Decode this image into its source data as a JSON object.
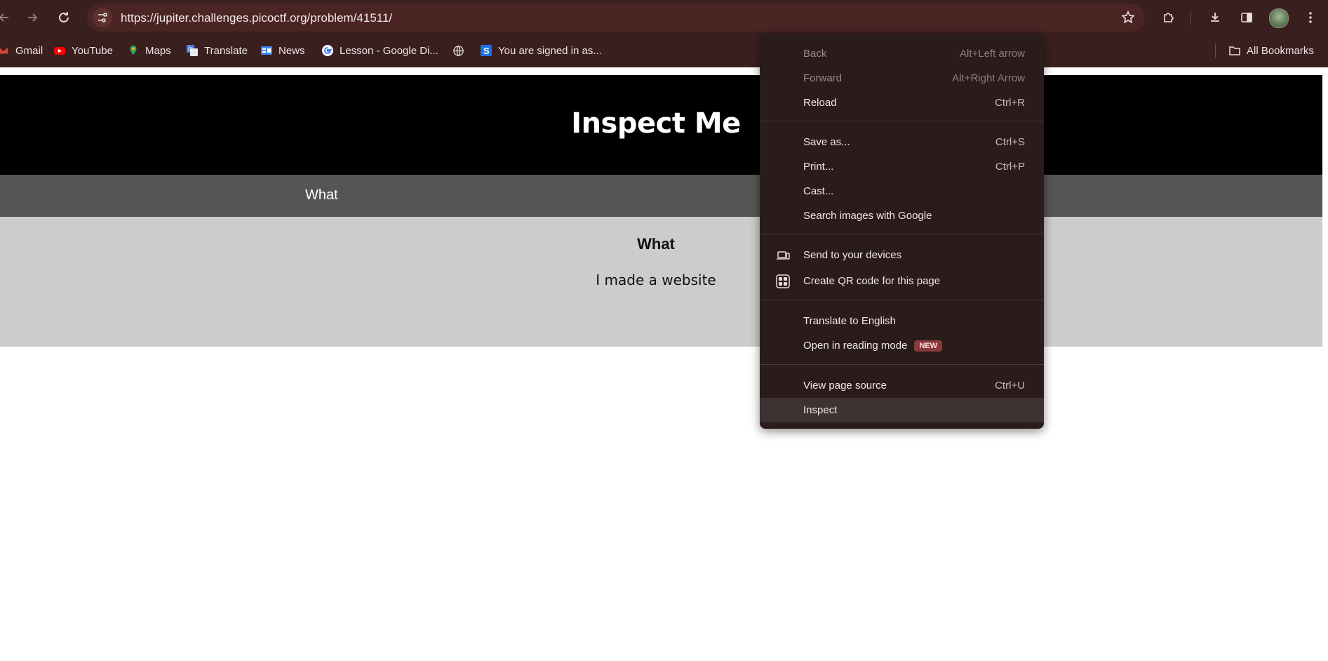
{
  "browser": {
    "url": "https://jupiter.challenges.picoctf.org/problem/41511/",
    "bookmarks": [
      {
        "label": "Gmail",
        "icon": "gmail-icon"
      },
      {
        "label": "YouTube",
        "icon": "youtube-icon"
      },
      {
        "label": "Maps",
        "icon": "maps-icon"
      },
      {
        "label": "Translate",
        "icon": "translate-icon"
      },
      {
        "label": "News",
        "icon": "news-icon"
      },
      {
        "label": "Lesson - Google Di...",
        "icon": "google-icon"
      },
      {
        "label": "",
        "icon": "globe-icon"
      },
      {
        "label": "You are signed in as...",
        "icon": "s-icon"
      }
    ],
    "all_bookmarks_label": "All Bookmarks"
  },
  "page": {
    "title": "Inspect Me",
    "nav_link": "What",
    "section_heading": "What",
    "section_text": "I made a website"
  },
  "context_menu": {
    "groups": [
      [
        {
          "label": "Back",
          "shortcut": "Alt+Left arrow",
          "disabled": true
        },
        {
          "label": "Forward",
          "shortcut": "Alt+Right Arrow",
          "disabled": true
        },
        {
          "label": "Reload",
          "shortcut": "Ctrl+R",
          "disabled": false
        }
      ],
      [
        {
          "label": "Save as...",
          "shortcut": "Ctrl+S",
          "disabled": false
        },
        {
          "label": "Print...",
          "shortcut": "Ctrl+P",
          "disabled": false
        },
        {
          "label": "Cast...",
          "shortcut": "",
          "disabled": false
        },
        {
          "label": "Search images with Google",
          "shortcut": "",
          "disabled": false
        }
      ],
      [
        {
          "label": "Send to your devices",
          "shortcut": "",
          "icon": "devices-icon"
        },
        {
          "label": "Create QR code for this page",
          "shortcut": "",
          "icon": "qr-code-icon"
        }
      ],
      [
        {
          "label": "Translate to English",
          "shortcut": ""
        },
        {
          "label": "Open in reading mode",
          "shortcut": "",
          "badge": "NEW"
        }
      ],
      [
        {
          "label": "View page source",
          "shortcut": "Ctrl+U"
        },
        {
          "label": "Inspect",
          "shortcut": "",
          "highlighted": true
        }
      ]
    ]
  },
  "colors": {
    "chrome_bg": "#3a1f1f",
    "menu_bg": "#2b1c1c",
    "hero_bg": "#000000",
    "nav_bg": "#555555",
    "content_bg": "#cccccc",
    "badge_bg": "#8a3a3a"
  }
}
